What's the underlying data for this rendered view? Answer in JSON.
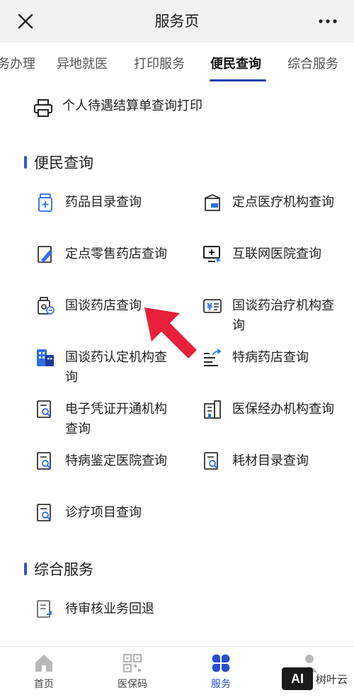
{
  "header": {
    "title": "服务页"
  },
  "tabs": [
    {
      "label": "务办理"
    },
    {
      "label": "异地就医"
    },
    {
      "label": "打印服务"
    },
    {
      "label": "便民查询",
      "active": true
    },
    {
      "label": "综合服务"
    }
  ],
  "print_item": {
    "label": "个人待遇结算单查询打印",
    "icon": "printer-icon"
  },
  "sections": {
    "convenience": "便民查询",
    "general": "综合服务"
  },
  "items": [
    {
      "label": "药品目录查询",
      "icon": "medicine-box-icon"
    },
    {
      "label": "定点医疗机构查询",
      "icon": "clinic-icon"
    },
    {
      "label": "定点零售药店查询",
      "icon": "pharmacy-doc-icon"
    },
    {
      "label": "互联网医院查询",
      "icon": "monitor-plus-icon"
    },
    {
      "label": "国谈药店查询",
      "icon": "pill-bottle-icon"
    },
    {
      "label": "国谈药治疗机构查询",
      "icon": "yen-card-icon"
    },
    {
      "label": "国谈药认定机构查询",
      "icon": "buildings-icon"
    },
    {
      "label": "特病药店查询",
      "icon": "list-share-icon"
    },
    {
      "label": "电子凭证开通机构查询",
      "icon": "doc-search-icon"
    },
    {
      "label": "医保经办机构查询",
      "icon": "office-building-icon"
    },
    {
      "label": "特病鉴定医院查询",
      "icon": "doc-search-icon"
    },
    {
      "label": "耗材目录查询",
      "icon": "doc-search-icon"
    },
    {
      "label": "诊疗项目查询",
      "icon": "doc-search-icon"
    }
  ],
  "general_items": [
    {
      "label": "待审核业务回退",
      "icon": "doc-return-icon"
    }
  ],
  "bottom_nav": [
    {
      "label": "首页",
      "icon": "home-icon"
    },
    {
      "label": "医保码",
      "icon": "qr-code-icon"
    },
    {
      "label": "服务",
      "icon": "clover-icon",
      "active": true
    },
    {
      "label": "",
      "icon": "profile-icon"
    }
  ],
  "watermark": {
    "logo": "AI",
    "name": "树叶云"
  },
  "colors": {
    "accent": "#2f56d3",
    "arrow": "#e8203a",
    "icon_blue": "#2f6fe0"
  }
}
